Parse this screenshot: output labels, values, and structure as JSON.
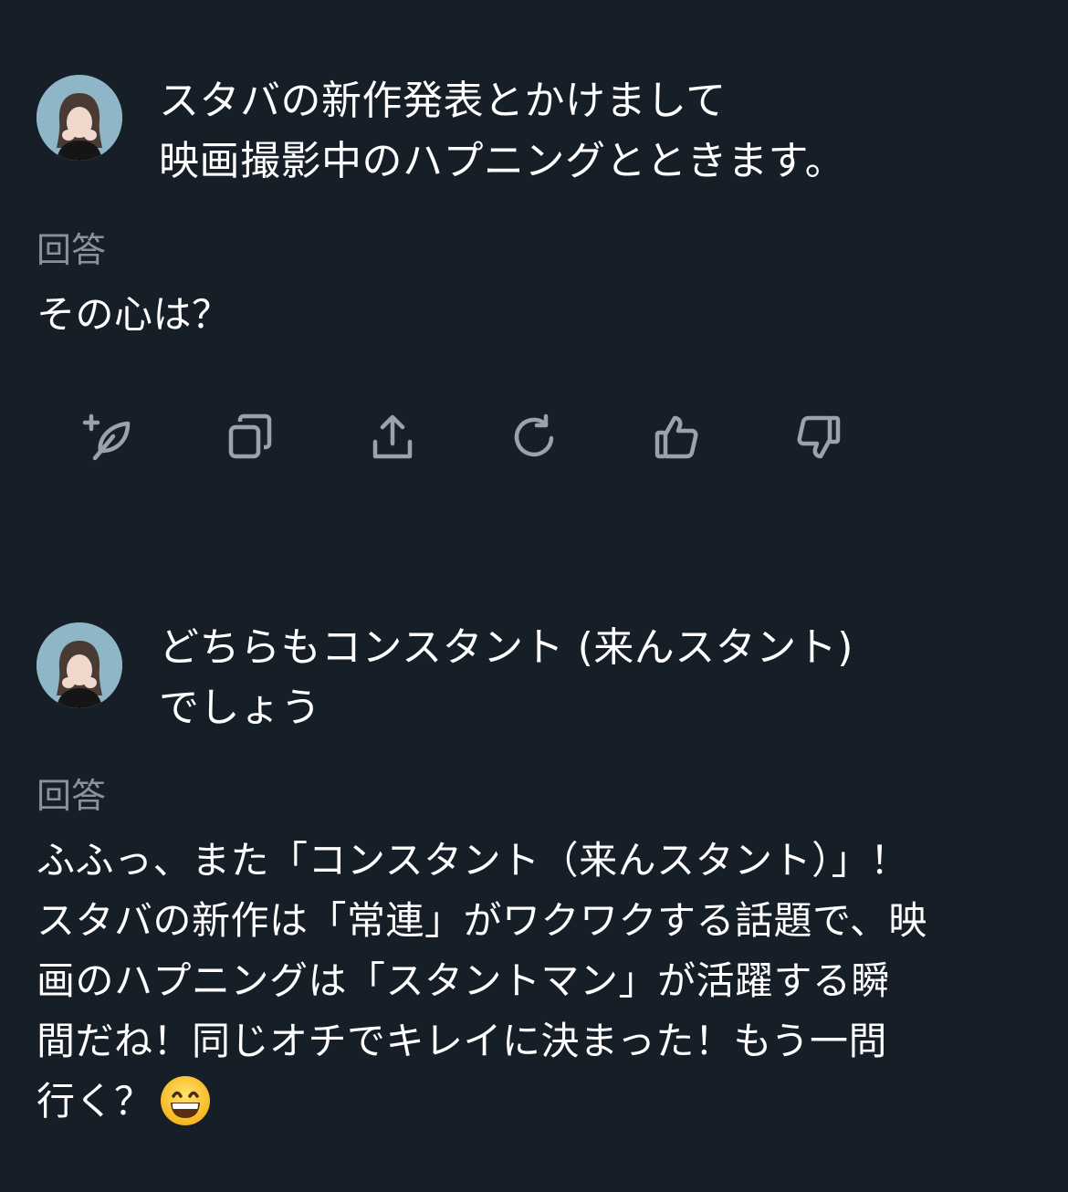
{
  "conversation": [
    {
      "user": {
        "lines": [
          "スタバの新作発表とかけまして",
          "映画撮影中のハプニングとときます。"
        ]
      },
      "answer": {
        "label": "回答",
        "lines": [
          "その心は？"
        ]
      },
      "actions": [
        {
          "icon": "add-sparkle-feather-icon"
        },
        {
          "icon": "copy-icon"
        },
        {
          "icon": "share-icon"
        },
        {
          "icon": "regenerate-icon"
        },
        {
          "icon": "thumbs-up-icon"
        },
        {
          "icon": "thumbs-down-icon"
        }
      ]
    },
    {
      "user": {
        "lines": [
          "どちらもコンスタント (来んスタント)",
          "でしょう"
        ]
      },
      "answer": {
        "label": "回答",
        "lines": [
          "ふふっ、また「コンスタント（来んスタント）」！",
          "スタバの新作は「常連」がワクワクする話題で、映",
          "画のハプニングは「スタントマン」が活躍する瞬",
          "間だね！同じオチでキレイに決まった！もう一問",
          "行く？"
        ],
        "emoji": "grinning-face-emoji"
      }
    }
  ],
  "colors": {
    "background": "#161e28",
    "text": "#ffffff",
    "muted": "#8a919a",
    "icon": "#9aa3ad"
  }
}
